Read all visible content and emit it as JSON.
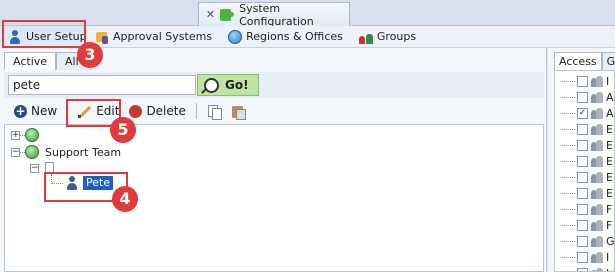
{
  "window_tab": {
    "title": "System Configuration"
  },
  "nav": {
    "items": [
      {
        "label": "User Setup",
        "icon": "user-icon"
      },
      {
        "label": "Approval Systems",
        "icon": "approval-icon"
      },
      {
        "label": "Regions & Offices",
        "icon": "globe-icon"
      },
      {
        "label": "Groups",
        "icon": "groups-icon"
      }
    ]
  },
  "subtabs": {
    "active": "Active",
    "all": "All"
  },
  "search": {
    "value": "pete",
    "go_label": "Go!"
  },
  "toolbar": {
    "new_label": "New",
    "edit_label": "Edit",
    "delete_label": "Delete"
  },
  "tree": {
    "team_label": "Support Team",
    "user_label": "Pete"
  },
  "right_panel": {
    "tab_access": "Access",
    "tab_other": "G",
    "rows": [
      {
        "letter": "I",
        "checked": false
      },
      {
        "letter": "A",
        "checked": false
      },
      {
        "letter": "A",
        "checked": true
      },
      {
        "letter": "E",
        "checked": false
      },
      {
        "letter": "E",
        "checked": false
      },
      {
        "letter": "E",
        "checked": false
      },
      {
        "letter": "E",
        "checked": false
      },
      {
        "letter": "E",
        "checked": false
      },
      {
        "letter": "F",
        "checked": false
      },
      {
        "letter": "F",
        "checked": false
      },
      {
        "letter": "G",
        "checked": false
      },
      {
        "letter": "I",
        "checked": false
      },
      {
        "letter": "I",
        "checked": false
      }
    ]
  },
  "callouts": {
    "c3": "3",
    "c4": "4",
    "c5": "5"
  },
  "colors": {
    "callout": "#e03a3a",
    "selection": "#1f5fc4",
    "go_button": "#bfe3a2"
  }
}
